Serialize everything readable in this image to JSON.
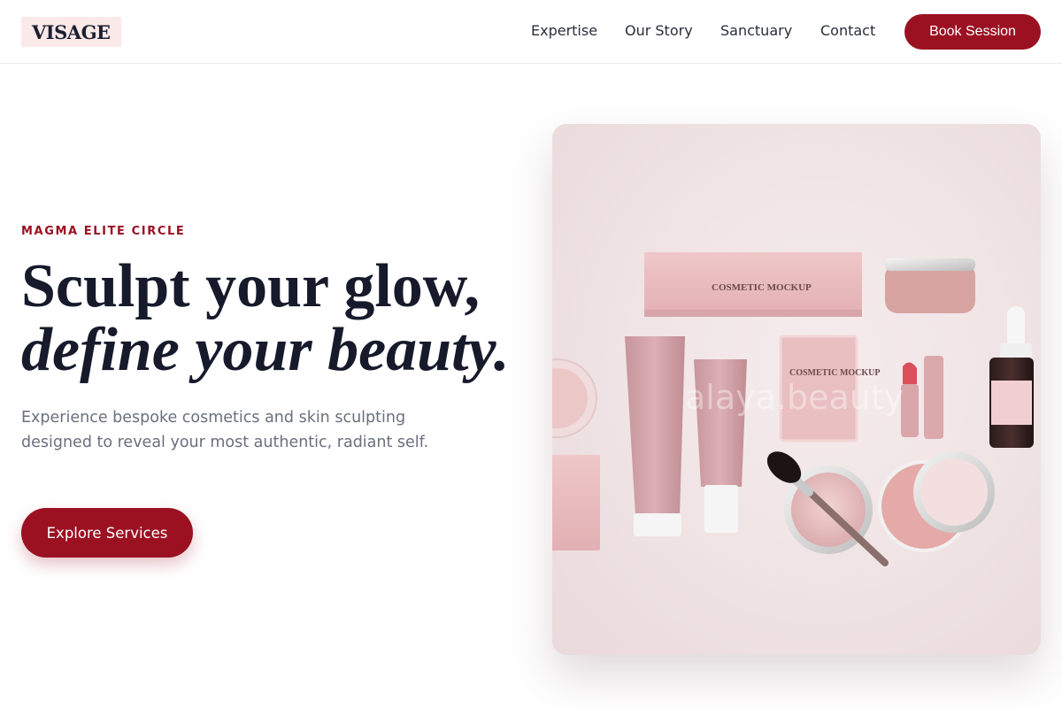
{
  "brand": {
    "logo_text": "VISAGE"
  },
  "nav": {
    "links": [
      {
        "label": "Expertise"
      },
      {
        "label": "Our Story"
      },
      {
        "label": "Sanctuary"
      },
      {
        "label": "Contact"
      }
    ],
    "cta_label": "Book Session"
  },
  "hero": {
    "eyebrow": "MAGMA ELITE CIRCLE",
    "headline_line1": "Sculpt your glow,",
    "headline_line2": "define your beauty.",
    "subtext": "Experience bespoke cosmetics and skin sculpting designed to reveal your most authentic, radiant self.",
    "cta_label": "Explore Services"
  },
  "product_image": {
    "box_label": "COSMETIC MOCKUP",
    "watermark": "alaya.beauty",
    "tube_label": "COSMETIC MOCKUP"
  },
  "colors": {
    "accent": "#9b1122",
    "logo_bg": "#fbe9ea",
    "product_pink": "#e7b9bd"
  }
}
